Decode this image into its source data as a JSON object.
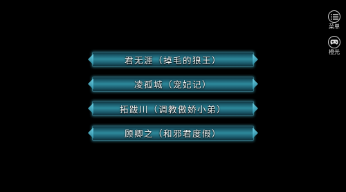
{
  "choices": [
    {
      "label": "君无涯（掉毛的狼王）"
    },
    {
      "label": "凌孤城（宠妃记）"
    },
    {
      "label": "拓跋川（调教傲娇小弟）"
    },
    {
      "label": "顾卿之（和邪君度假）"
    }
  ],
  "sidebar": {
    "menu": {
      "label": "菜单",
      "icon": "list-menu-icon"
    },
    "archive": {
      "label": "橙光",
      "icon": "gamepad-icon"
    }
  },
  "colors": {
    "background": "#000000",
    "button_glow": "#2e8a9c",
    "button_text": "#f2f6f7"
  }
}
